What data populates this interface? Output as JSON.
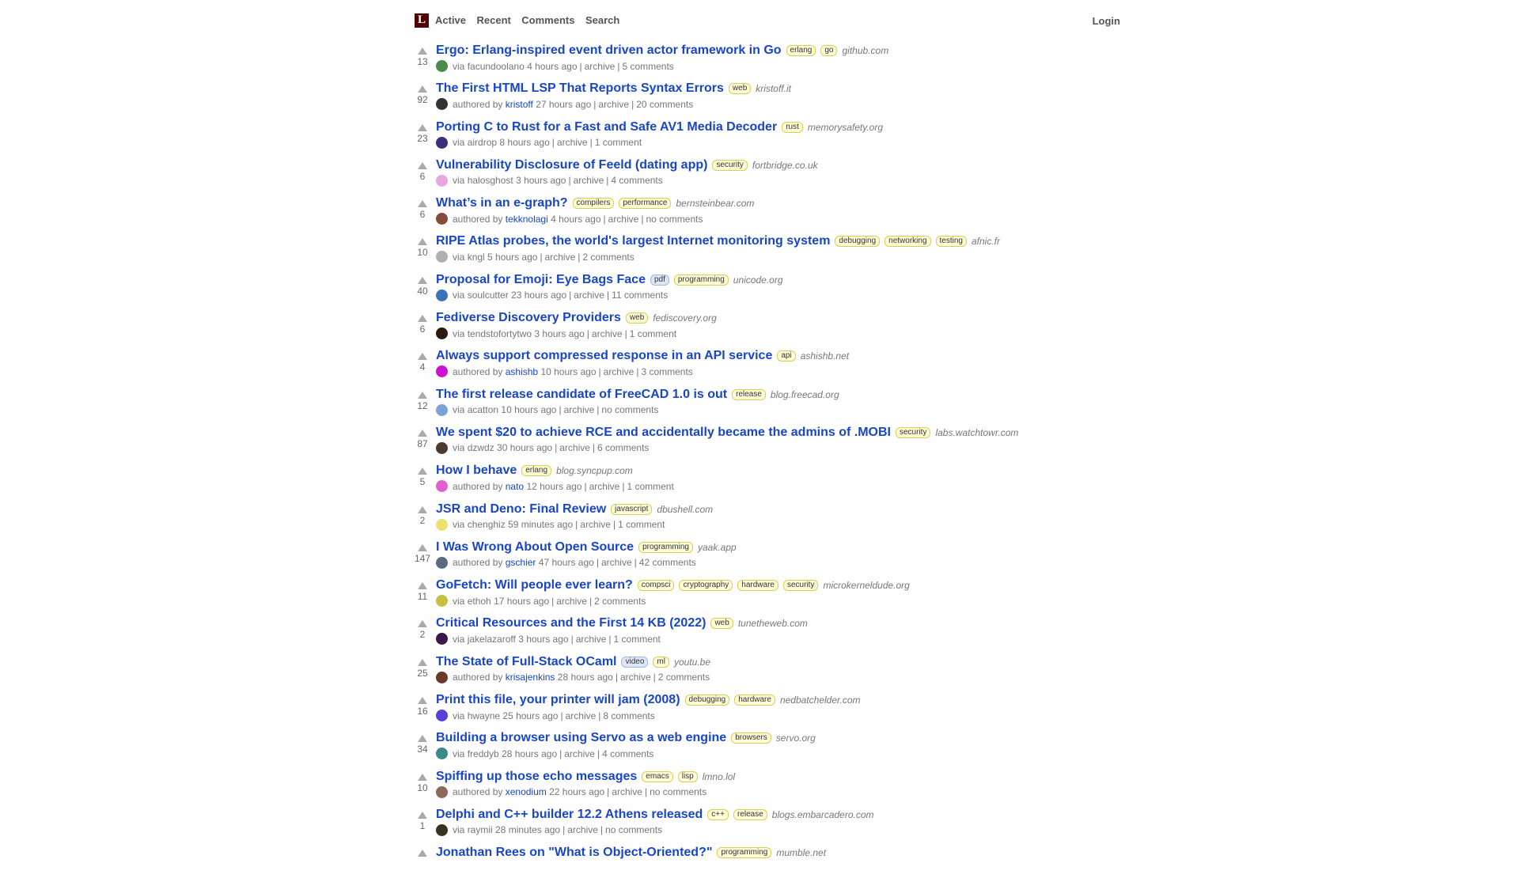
{
  "header": {
    "logo": "L",
    "nav": [
      "Active",
      "Recent",
      "Comments",
      "Search"
    ],
    "login": "Login"
  },
  "colors": {
    "link": "#1946c6",
    "logo_bg": "#500000",
    "tag_bg": "#fffcd7",
    "media_tag_bg": "#dde7f6"
  },
  "stories": [
    {
      "score": "13",
      "title": "Ergo: Erlang-inspired event driven actor framework in Go",
      "tags": [
        "erlang",
        "go"
      ],
      "media_tags": [],
      "domain": "github.com",
      "by_prefix": "via",
      "user": "facundoolano",
      "authored": false,
      "time": "4 hours ago",
      "archive": "archive",
      "comments": "5 comments",
      "avatar_color": "#4a8a4a"
    },
    {
      "score": "92",
      "title": "The First HTML LSP That Reports Syntax Errors",
      "tags": [
        "web"
      ],
      "media_tags": [],
      "domain": "kristoff.it",
      "by_prefix": "authored by",
      "user": "kristoff",
      "authored": true,
      "time": "27 hours ago",
      "archive": "archive",
      "comments": "20 comments",
      "avatar_color": "#333333"
    },
    {
      "score": "23",
      "title": "Porting C to Rust for a Fast and Safe AV1 Media Decoder",
      "tags": [
        "rust"
      ],
      "media_tags": [],
      "domain": "memorysafety.org",
      "by_prefix": "via",
      "user": "airdrop",
      "authored": false,
      "time": "8 hours ago",
      "archive": "archive",
      "comments": "1 comment",
      "avatar_color": "#3a2f7a"
    },
    {
      "score": "6",
      "title": "Vulnerability Disclosure of Feeld (dating app)",
      "tags": [
        "security"
      ],
      "media_tags": [],
      "domain": "fortbridge.co.uk",
      "by_prefix": "via",
      "user": "halosghost",
      "authored": false,
      "time": "3 hours ago",
      "archive": "archive",
      "comments": "4 comments",
      "avatar_color": "#e7a6e0"
    },
    {
      "score": "6",
      "title": "What’s in an e-graph?",
      "tags": [
        "compilers",
        "performance"
      ],
      "media_tags": [],
      "domain": "bernsteinbear.com",
      "by_prefix": "authored by",
      "user": "tekknolagi",
      "authored": true,
      "time": "4 hours ago",
      "archive": "archive",
      "comments": "no comments",
      "avatar_color": "#8a4a3a"
    },
    {
      "score": "10",
      "title": "RIPE Atlas probes, the world's largest Internet monitoring system",
      "tags": [
        "debugging",
        "networking",
        "testing"
      ],
      "media_tags": [],
      "domain": "afnic.fr",
      "by_prefix": "via",
      "user": "kngl",
      "authored": false,
      "time": "5 hours ago",
      "archive": "archive",
      "comments": "2 comments",
      "avatar_color": "#b0b0b0"
    },
    {
      "score": "40",
      "title": "Proposal for Emoji: Eye Bags Face",
      "tags": [
        "programming"
      ],
      "media_tags": [
        "pdf"
      ],
      "domain": "unicode.org",
      "by_prefix": "via",
      "user": "soulcutter",
      "authored": false,
      "time": "23 hours ago",
      "archive": "archive",
      "comments": "11 comments",
      "avatar_color": "#3a72b8"
    },
    {
      "score": "6",
      "title": "Fediverse Discovery Providers",
      "tags": [
        "web"
      ],
      "media_tags": [],
      "domain": "fediscovery.org",
      "by_prefix": "via",
      "user": "tendstofortytwo",
      "authored": false,
      "time": "3 hours ago",
      "archive": "archive",
      "comments": "1 comment",
      "avatar_color": "#2a1a10"
    },
    {
      "score": "4",
      "title": "Always support compressed response in an API service",
      "tags": [
        "api"
      ],
      "media_tags": [],
      "domain": "ashishb.net",
      "by_prefix": "authored by",
      "user": "ashishb",
      "authored": true,
      "time": "10 hours ago",
      "archive": "archive",
      "comments": "3 comments",
      "avatar_color": "#d010d0"
    },
    {
      "score": "12",
      "title": "The first release candidate of FreeCAD 1.0 is out",
      "tags": [
        "release"
      ],
      "media_tags": [],
      "domain": "blog.freecad.org",
      "by_prefix": "via",
      "user": "acatton",
      "authored": false,
      "time": "10 hours ago",
      "archive": "archive",
      "comments": "no comments",
      "avatar_color": "#7aa4d8"
    },
    {
      "score": "87",
      "title": "We spent $20 to achieve RCE and accidentally became the admins of .MOBI",
      "tags": [
        "security"
      ],
      "media_tags": [],
      "domain": "labs.watchtowr.com",
      "by_prefix": "via",
      "user": "dzwdz",
      "authored": false,
      "time": "30 hours ago",
      "archive": "archive",
      "comments": "6 comments",
      "avatar_color": "#4a3a30"
    },
    {
      "score": "5",
      "title": "How I behave",
      "tags": [
        "erlang"
      ],
      "media_tags": [],
      "domain": "blog.syncpup.com",
      "by_prefix": "authored by",
      "user": "nato",
      "authored": true,
      "time": "12 hours ago",
      "archive": "archive",
      "comments": "1 comment",
      "avatar_color": "#e060d0"
    },
    {
      "score": "2",
      "title": "JSR and Deno: Final Review",
      "tags": [
        "javascript"
      ],
      "media_tags": [],
      "domain": "dbushell.com",
      "by_prefix": "via",
      "user": "chenghiz",
      "authored": false,
      "time": "59 minutes ago",
      "archive": "archive",
      "comments": "1 comment",
      "avatar_color": "#eee070"
    },
    {
      "score": "147",
      "title": "I Was Wrong About Open Source",
      "tags": [
        "programming"
      ],
      "media_tags": [],
      "domain": "yaak.app",
      "by_prefix": "authored by",
      "user": "gschier",
      "authored": true,
      "time": "47 hours ago",
      "archive": "archive",
      "comments": "42 comments",
      "avatar_color": "#5a6a80"
    },
    {
      "score": "11",
      "title": "GoFetch: Will people ever learn?",
      "tags": [
        "compsci",
        "cryptography",
        "hardware",
        "security"
      ],
      "media_tags": [],
      "domain": "microkerneldude.org",
      "by_prefix": "via",
      "user": "ethoh",
      "authored": false,
      "time": "17 hours ago",
      "archive": "archive",
      "comments": "2 comments",
      "avatar_color": "#c8c040"
    },
    {
      "score": "2",
      "title": "Critical Resources and the First 14 KB (2022)",
      "tags": [
        "web"
      ],
      "media_tags": [],
      "domain": "tunetheweb.com",
      "by_prefix": "via",
      "user": "jakelazaroff",
      "authored": false,
      "time": "3 hours ago",
      "archive": "archive",
      "comments": "1 comment",
      "avatar_color": "#3a1a4a"
    },
    {
      "score": "25",
      "title": "The State of Full-Stack OCaml",
      "tags": [
        "ml"
      ],
      "media_tags": [
        "video"
      ],
      "domain": "youtu.be",
      "by_prefix": "authored by",
      "user": "krisajenkins",
      "authored": true,
      "time": "28 hours ago",
      "archive": "archive",
      "comments": "2 comments",
      "avatar_color": "#6a3a2a"
    },
    {
      "score": "16",
      "title": "Print this file, your printer will jam (2008)",
      "tags": [
        "debugging",
        "hardware"
      ],
      "media_tags": [],
      "domain": "nedbatchelder.com",
      "by_prefix": "via",
      "user": "hwayne",
      "authored": false,
      "time": "25 hours ago",
      "archive": "archive",
      "comments": "8 comments",
      "avatar_color": "#5a40d8"
    },
    {
      "score": "34",
      "title": "Building a browser using Servo as a web engine",
      "tags": [
        "browsers"
      ],
      "media_tags": [],
      "domain": "servo.org",
      "by_prefix": "via",
      "user": "freddyb",
      "authored": false,
      "time": "28 hours ago",
      "archive": "archive",
      "comments": "4 comments",
      "avatar_color": "#3a8a8a"
    },
    {
      "score": "10",
      "title": "Spiffing up those echo messages",
      "tags": [
        "emacs",
        "lisp"
      ],
      "media_tags": [],
      "domain": "lmno.lol",
      "by_prefix": "authored by",
      "user": "xenodium",
      "authored": true,
      "time": "22 hours ago",
      "archive": "archive",
      "comments": "no comments",
      "avatar_color": "#8a6a5a"
    },
    {
      "score": "1",
      "title": "Delphi and C++ builder 12.2 Athens released",
      "tags": [
        "c++",
        "release"
      ],
      "media_tags": [],
      "domain": "blogs.embarcadero.com",
      "by_prefix": "via",
      "user": "raymii",
      "authored": false,
      "time": "28 minutes ago",
      "archive": "archive",
      "comments": "no comments",
      "avatar_color": "#3a3020"
    },
    {
      "score": "",
      "title": "Jonathan Rees on \"What is Object-Oriented?\"",
      "tags": [
        "programming"
      ],
      "media_tags": [],
      "domain": "mumble.net",
      "by_prefix": "",
      "user": "",
      "authored": false,
      "time": "",
      "archive": "",
      "comments": "",
      "avatar_color": "#ffffff"
    }
  ]
}
